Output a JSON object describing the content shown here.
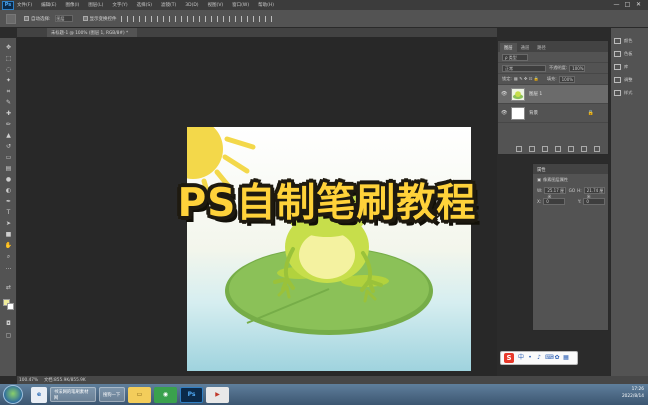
{
  "app": {
    "logo": "Ps"
  },
  "menubar": {
    "items": [
      "文件(F)",
      "编辑(E)",
      "图像(I)",
      "图层(L)",
      "文字(Y)",
      "选择(S)",
      "滤镜(T)",
      "3D(D)",
      "视图(V)",
      "窗口(W)",
      "帮助(H)"
    ],
    "window_buttons": [
      "—",
      "□",
      "✕"
    ]
  },
  "optionsbar": {
    "auto_select_label": "自动选择:",
    "auto_select_value": "图层",
    "show_transform_label": "显示变换控件"
  },
  "document": {
    "tab_label": "未标题-1 @ 100% (图层 1, RGB/8#) *"
  },
  "title_overlay": "PS自制笔刷教程",
  "colors": {
    "foreground": "#f0ec9c",
    "background": "#ffffff",
    "title_fill": "#ffd23a"
  },
  "layers_panel": {
    "tabs": [
      "图层",
      "通道",
      "路径"
    ],
    "kind_filter": "ρ 类型",
    "blend_mode": "正常",
    "opacity_label": "不透明度:",
    "opacity_value": "100%",
    "lock_label": "锁定:",
    "fill_label": "填充:",
    "fill_value": "100%",
    "layers": [
      {
        "name": "图层 1",
        "selected": true,
        "thumb": "frog"
      },
      {
        "name": "背景",
        "selected": false,
        "thumb": "white",
        "locked": true
      }
    ]
  },
  "properties_panel": {
    "title": "属性",
    "subtitle": "像素图层属性",
    "w_label": "W:",
    "w_value": "25.17 厘米",
    "h_label": "H:",
    "h_value": "21.74 厘米",
    "go_label": "GO",
    "x_label": "X:",
    "x_value": "0",
    "y_label": "Y:",
    "y_value": "0"
  },
  "right_strip": {
    "items": [
      "颜色",
      "色板",
      "库",
      "调整",
      "样式"
    ]
  },
  "statusbar": {
    "zoom": "100.47%",
    "doc_size": "文档:855.9K/855.9K"
  },
  "ime": {
    "logo": "S"
  },
  "taskbar": {
    "tasks": [
      "书法网的笔刷素材网",
      "搜狗一下"
    ],
    "apps": [
      "Ps"
    ],
    "time": "17:26",
    "date": "2022/8/14"
  }
}
